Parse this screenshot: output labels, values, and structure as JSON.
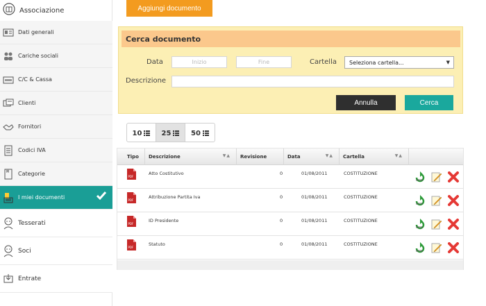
{
  "sidebar": {
    "top": {
      "label": "Associazione",
      "icon": "building-icon"
    },
    "items": [
      {
        "label": "Dati generali",
        "icon": "id-card-icon"
      },
      {
        "label": "Cariche sociali",
        "icon": "users-icon"
      },
      {
        "label": "C/C & Cassa",
        "icon": "cash-icon"
      },
      {
        "label": "Clienti",
        "icon": "clients-icon"
      },
      {
        "label": "Fornitori",
        "icon": "handshake-icon"
      },
      {
        "label": "Codici IVA",
        "icon": "document-icon"
      },
      {
        "label": "Categorie",
        "icon": "folder-icon"
      },
      {
        "label": "I miei documenti",
        "icon": "documents-icon",
        "active": true
      },
      {
        "label": "Tesserati",
        "icon": "person-icon"
      },
      {
        "label": "Soci",
        "icon": "person-icon"
      },
      {
        "label": "Entrate",
        "icon": "income-icon"
      }
    ]
  },
  "main": {
    "add_label": "Aggiungi documento",
    "search": {
      "title": "Cerca documento",
      "data_label": "Data",
      "inizio_placeholder": "Inizio",
      "fine_placeholder": "Fine",
      "cartella_label": "Cartella",
      "cartella_value": "Seleziona cartella...",
      "descrizione_label": "Descrizione",
      "annulla_label": "Annulla",
      "cerca_label": "Cerca"
    },
    "pager": [
      {
        "label": "10"
      },
      {
        "label": "25",
        "selected": true
      },
      {
        "label": "50"
      }
    ],
    "table": {
      "headers": {
        "tipo": "Tipo",
        "descrizione": "Descrizione",
        "revisione": "Revisione",
        "data": "Data",
        "cartella": "Cartella"
      },
      "rows": [
        {
          "descrizione": "Atto Costitutivo",
          "revisione": "0",
          "data": "01/08/2011",
          "cartella": "COSTITUZIONE"
        },
        {
          "descrizione": "Attribuzione Partita Iva",
          "revisione": "0",
          "data": "01/08/2011",
          "cartella": "COSTITUZIONE"
        },
        {
          "descrizione": "ID Presidente",
          "revisione": "0",
          "data": "01/08/2011",
          "cartella": "COSTITUZIONE"
        },
        {
          "descrizione": "Statuto",
          "revisione": "0",
          "data": "01/08/2011",
          "cartella": "COSTITUZIONE"
        }
      ]
    }
  },
  "colors": {
    "accent_orange": "#f39b1f",
    "active_teal": "#1a9e96",
    "cerca_teal": "#1aa89d",
    "panel_yellow": "#fcefb4",
    "panel_title": "#fbc88c",
    "delete_red": "#e53935",
    "restore_green": "#2e9b3a"
  }
}
